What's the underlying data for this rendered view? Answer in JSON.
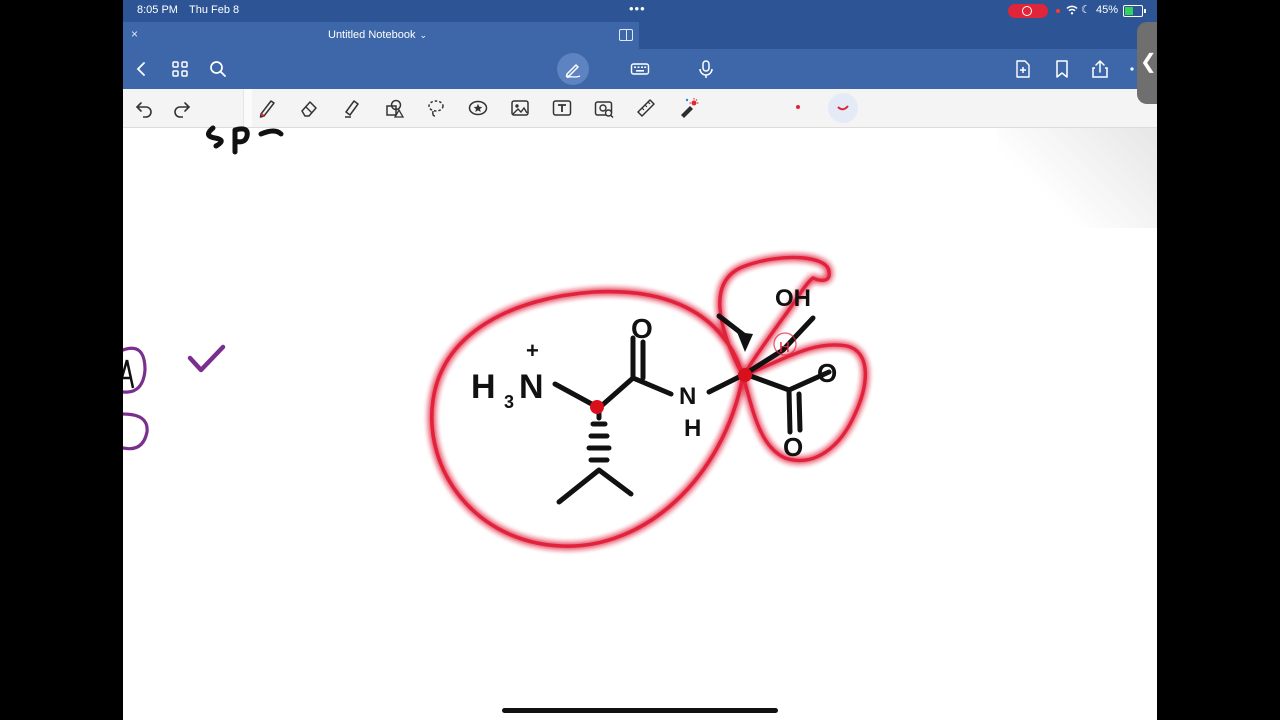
{
  "status_bar": {
    "time": "8:05 PM",
    "date": "Thu Feb 8",
    "battery_percent": "45%",
    "recording": true
  },
  "tab": {
    "title": "Untitled Notebook",
    "close_glyph": "×",
    "chevron_glyph": "⌄"
  },
  "nav": {
    "icons": [
      "back-icon",
      "grid-icon",
      "search-icon",
      "pen-mode-icon",
      "keyboard-icon",
      "microphone-icon",
      "add-page-icon",
      "bookmark-icon",
      "share-icon",
      "more-icon"
    ]
  },
  "toolbar": {
    "tools": [
      "undo-icon",
      "redo-icon",
      "pen-icon",
      "eraser-icon",
      "highlighter-icon",
      "shapes-icon",
      "lasso-icon",
      "sticker-icon",
      "image-icon",
      "text-icon",
      "camera-scan-icon",
      "ruler-icon",
      "laser-pointer-icon"
    ],
    "active_color": "#e0243a"
  },
  "canvas": {
    "handwriting": {
      "partial_top": "sp",
      "left_label_a": "A",
      "nh3_h": "H",
      "nh3_sub": "3",
      "nh3_n": "N",
      "nh3_charge": "+",
      "carbonyl_o": "O",
      "amide_n": "N",
      "amide_h": "H",
      "hydroxyl": "OH",
      "circled_h": "H",
      "acid_o_top": "O",
      "acid_o_bottom": "O"
    },
    "ink_colors": {
      "black": "#111111",
      "red_highlight": "#e0243a",
      "purple": "#7a2f8f"
    }
  },
  "side_handle": {
    "glyph": "❮"
  }
}
